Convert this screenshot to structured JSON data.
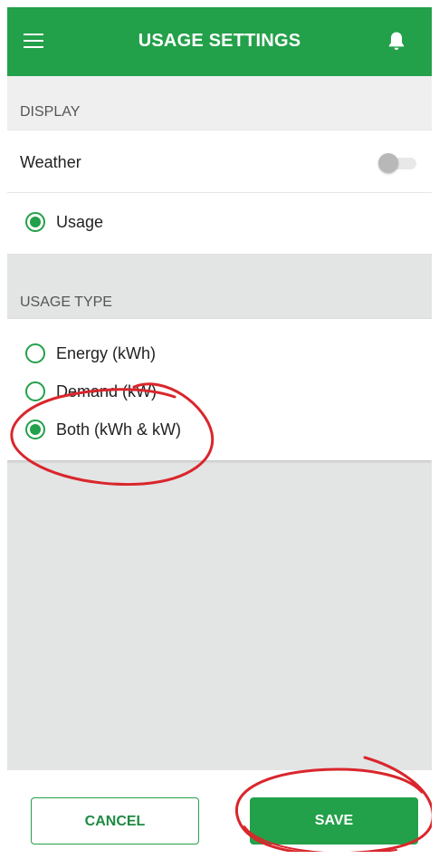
{
  "header": {
    "title": "USAGE SETTINGS",
    "menu_icon": "hamburger-menu-icon",
    "bell_icon": "bell-icon"
  },
  "display_section": {
    "title": "DISPLAY",
    "weather_label": "Weather",
    "weather_toggle_on": false,
    "usage_label": "Usage",
    "usage_selected": true
  },
  "usage_type_section": {
    "title": "USAGE TYPE",
    "options": [
      {
        "label": "Energy (kWh)",
        "selected": false
      },
      {
        "label": "Demand (kW)",
        "selected": false
      },
      {
        "label": "Both (kWh & kW)",
        "selected": true
      }
    ]
  },
  "footer": {
    "cancel_label": "CANCEL",
    "save_label": "SAVE"
  },
  "colors": {
    "brand_green": "#23a04a",
    "annotation_red": "#d9262c",
    "background_gray": "#e3e4e4"
  }
}
